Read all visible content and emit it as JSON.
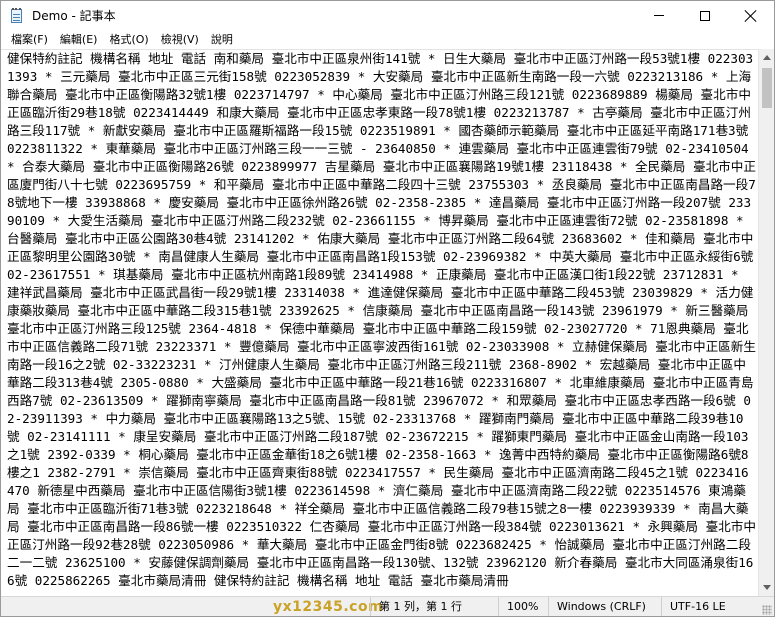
{
  "window": {
    "title": "Demo - 記事本"
  },
  "menu": {
    "items": [
      "檔案(F)",
      "編輯(E)",
      "格式(O)",
      "檢視(V)",
      "說明"
    ]
  },
  "editor": {
    "content": "健保特約註記 機構名稱 地址 電話 南和藥局 臺北市中正區泉州街141號 * 日生大藥局 臺北市中正區汀州路一段53號1樓 0223031393 * 三元藥局 臺北市中正區三元街158號 0223052839 * 大安藥局 臺北市中正區新生南路一段一六號 0223213186 * 上海聯合藥局 臺北市中正區衡陽路32號1樓 0223714797 * 中心藥局 臺北市中正區汀州路三段121號 0223689889 楊藥局 臺北市中正區臨沂街29巷18號 0223414449 和康大藥局 臺北市中正區忠孝東路一段78號1樓 0223213787 * 古亭藥局 臺北市中正區汀州路三段117號 * 新獻安藥局 臺北市中正區羅斯福路一段15號 0223519891 * 國杏藥師示範藥局 臺北市中正區延平南路171巷3號 0223811322 * 東華藥局 臺北市中正區汀州路三段一一三號 - 23640850 * 連雲藥局 臺北市中正區連雲街79號 02-23410504 * 合泰大藥局 臺北市中正區衡陽路26號 0223899977 吉星藥局 臺北市中正區襄陽路19號1樓 23118438 * 全民藥局 臺北市中正區廈門街八十七號 0223695759 * 和平藥局 臺北市中正區中華路二段四十三號 23755303 * 丞良藥局 臺北市中正區南昌路一段78號地下一樓 33938868 * 慶安藥局 臺北市中正區徐州路26號 02-2358-2385 * 達昌藥局 臺北市中正區汀州路一段207號 23390109 * 大愛生活藥局 臺北市中正區汀州路二段232號 02-23661155 * 博昇藥局 臺北市中正區連雲街72號 02-23581898 * 台醫藥局 臺北市中正區公園路30巷4號 23141202 * 佑康大藥局 臺北市中正區汀州路二段64號 23683602 * 佳和藥局 臺北市中正區黎明里公園路30號 * 南昌健康人生藥局 臺北市中正區南昌路1段153號 02-23969382 * 中英大藥局 臺北市中正區永綏街6號 02-23617551 * 琪基藥局 臺北市中正區杭州南路1段89號 23414988 * 正康藥局 臺北市中正區漢口街1段22號 23712831 * 建祥武昌藥局 臺北市中正區武昌街一段29號1樓 23314038 * 進達健保藥局 臺北市中正區中華路二段453號 23039829 * 活力健康藥妝藥局 臺北市中正區中華路二段315巷1號 23392625 * 信康藥局 臺北市中正區南昌路一段143號 23961979 * 新三醫藥局 臺北市中正區汀州路三段125號 2364-4818 * 保德中華藥局 臺北市中正區中華路二段159號 02-23027720 * 71恩典藥局 臺北市中正區信義路二段71號 23223371 * 豐億藥局 臺北市中正區寧波西街161號 02-23033908 * 立赫健保藥局 臺北市中正區新生南路一段16之2號 02-33223231 * 汀州健康人生藥局 臺北市中正區汀州路三段211號 2368-8902 * 宏越藥局 臺北市中正區中華路二段313巷4號 2305-0880 * 大盛藥局 臺北市中正區中華路一段21巷16號 0223316807 * 北車維康藥局 臺北市中正區青島西路7號 02-23613509 * 躍獅南寧藥局 臺北市中正區南昌路一段81號 23967072 * 和眾藥局 臺北市中正區忠孝西路一段6號 02-23911393 * 中力藥局 臺北市中正區襄陽路13之5號、15號 02-23313768 * 躍獅南門藥局 臺北市中正區中華路二段39巷10號 02-23141111 * 康呈安藥局 臺北市中正區汀州路二段187號 02-23672215 * 躍獅東門藥局 臺北市中正區金山南路一段103之1號 2392-0339 * 桐心藥局 臺北市中正區金華街18之6號1樓 02-2358-1663 * 逸菁中西特約藥局 臺北市中正區衡陽路6號8樓之1 2382-2791 * 崇信藥局 臺北市中正區齊東街88號 0223417557 * 民生藥局 臺北市中正區濟南路二段45之1號 0223416470 新德星中西藥局 臺北市中正區信陽街3號1樓 0223614598 * 濟仁藥局 臺北市中正區濟南路二段22號 0223514576 東鴻藥局 臺北市中正區臨沂街71巷3號 0223218648 * 祥全藥局 臺北市中正區信義路二段79巷15號之8一樓 0223939339 * 南昌大藥局 臺北市中正區南昌路一段86號一樓 0223510322 仁杏藥局 臺北市中正區汀州路一段384號 0223013621 * 永興藥局 臺北市中正區汀州路一段92巷28號 0223050986 * 華大藥局 臺北市中正區金門街8號 0223682425 * 怡誠藥局 臺北市中正區汀州路二段二一二號 23625100 * 安藤健保調劑藥局 臺北市中正區南昌路一段130號、132號 23962120 新介春藥局 臺北市大同區涌泉街166號 0225862265 臺北市藥局清冊 健保特約註記 機構名稱 地址 電話 臺北市藥局清冊"
  },
  "statusbar": {
    "position": "第 1 列，第 1 行",
    "zoom": "100%",
    "line_ending": "Windows (CRLF)",
    "encoding": "UTF-16 LE",
    "watermark": "yx12345.com"
  }
}
